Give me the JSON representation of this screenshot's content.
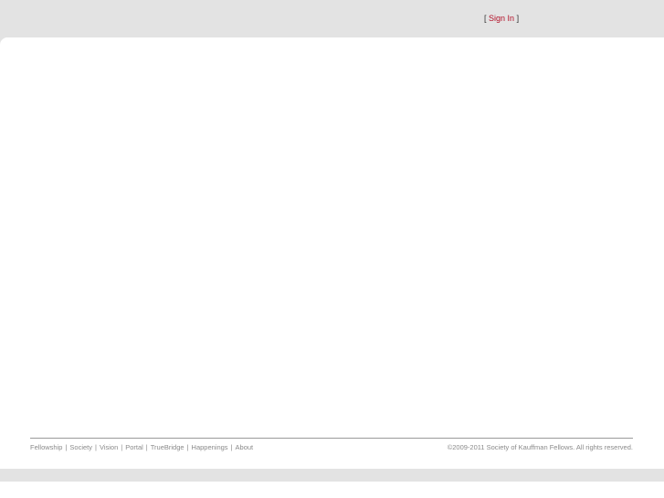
{
  "header": {
    "signin_open": "[",
    "signin_label": "Sign In",
    "signin_close": "]"
  },
  "footer": {
    "nav": [
      {
        "label": "Fellowship"
      },
      {
        "label": "Society"
      },
      {
        "label": "Vision"
      },
      {
        "label": "Portal"
      },
      {
        "label": "TrueBridge"
      },
      {
        "label": "Happenings"
      },
      {
        "label": "About"
      }
    ],
    "separator": "|",
    "copyright": "©2009-2011 Society of Kauffman Fellows. All rights reserved."
  },
  "colors": {
    "background": "#e3e3e3",
    "content": "#ffffff",
    "accent_link": "#b3122a",
    "footer_text": "#8a8a8a"
  }
}
